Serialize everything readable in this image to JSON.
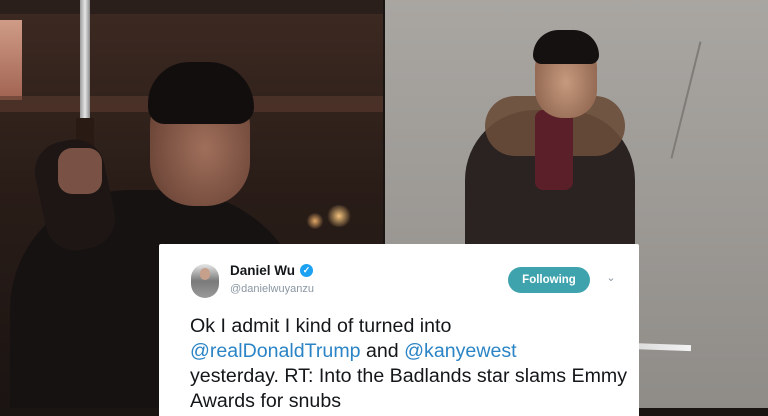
{
  "tweet": {
    "display_name": "Daniel Wu",
    "handle": "@danielwuyanzu",
    "follow_label": "Following",
    "text_part1": "Ok I admit I kind of turned into",
    "mention1": "@realDonaldTrump",
    "text_and": " and ",
    "mention2": "@kanyewest",
    "text_part2": "yesterday. RT: Into the Badlands star slams Emmy Awards for snubs"
  },
  "icons": {
    "verified": "verified-badge-icon",
    "menu": "chevron-down-icon"
  },
  "colors": {
    "follow_button": "#3fa3ae",
    "mention": "#2a84c5",
    "verified": "#1da1f2"
  }
}
